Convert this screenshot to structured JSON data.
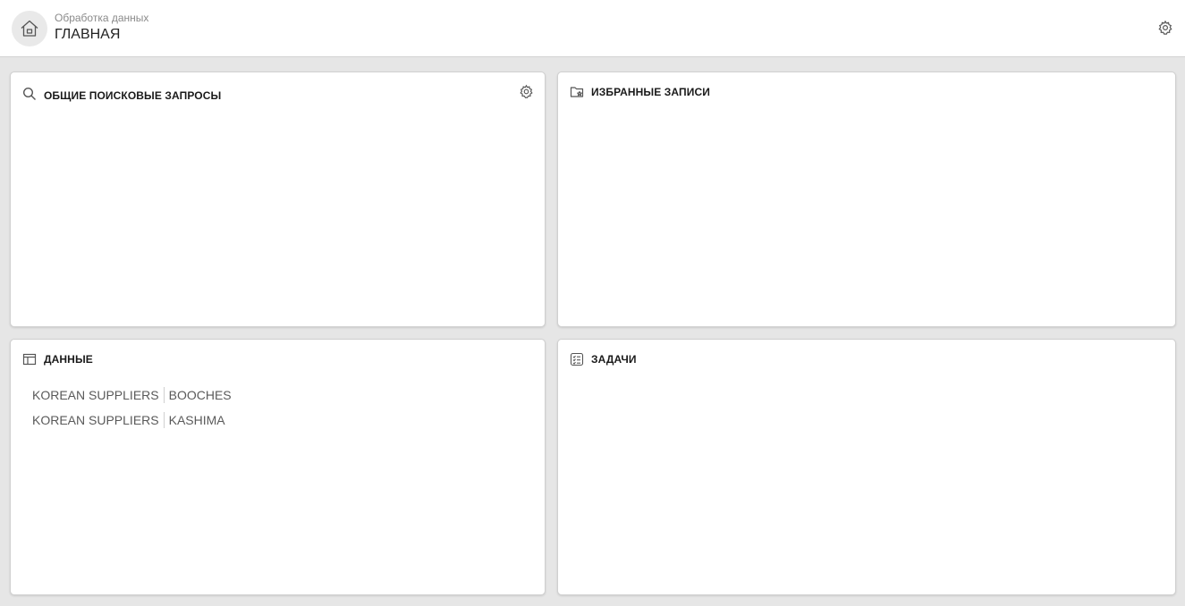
{
  "header": {
    "subtitle": "Обработка данных",
    "title": "ГЛАВНАЯ"
  },
  "panels": {
    "searches": {
      "title": "ОБЩИЕ ПОИСКОВЫЕ ЗАПРОСЫ",
      "icon": "search-icon"
    },
    "favorites": {
      "title": "ИЗБРАННЫЕ ЗАПИСИ",
      "icon": "folder-star-icon"
    },
    "data": {
      "title": "ДАННЫЕ",
      "icon": "table-icon",
      "items": [
        {
          "group": "KOREAN SUPPLIERS",
          "name": "BOOCHES"
        },
        {
          "group": "KOREAN SUPPLIERS",
          "name": "KASHIMA"
        }
      ]
    },
    "tasks": {
      "title": "ЗАДАЧИ",
      "icon": "tasks-icon"
    }
  },
  "colors": {
    "background": "#e6e6e6",
    "panel": "#ffffff",
    "border": "#d0d0d0",
    "icon": "#555555"
  }
}
